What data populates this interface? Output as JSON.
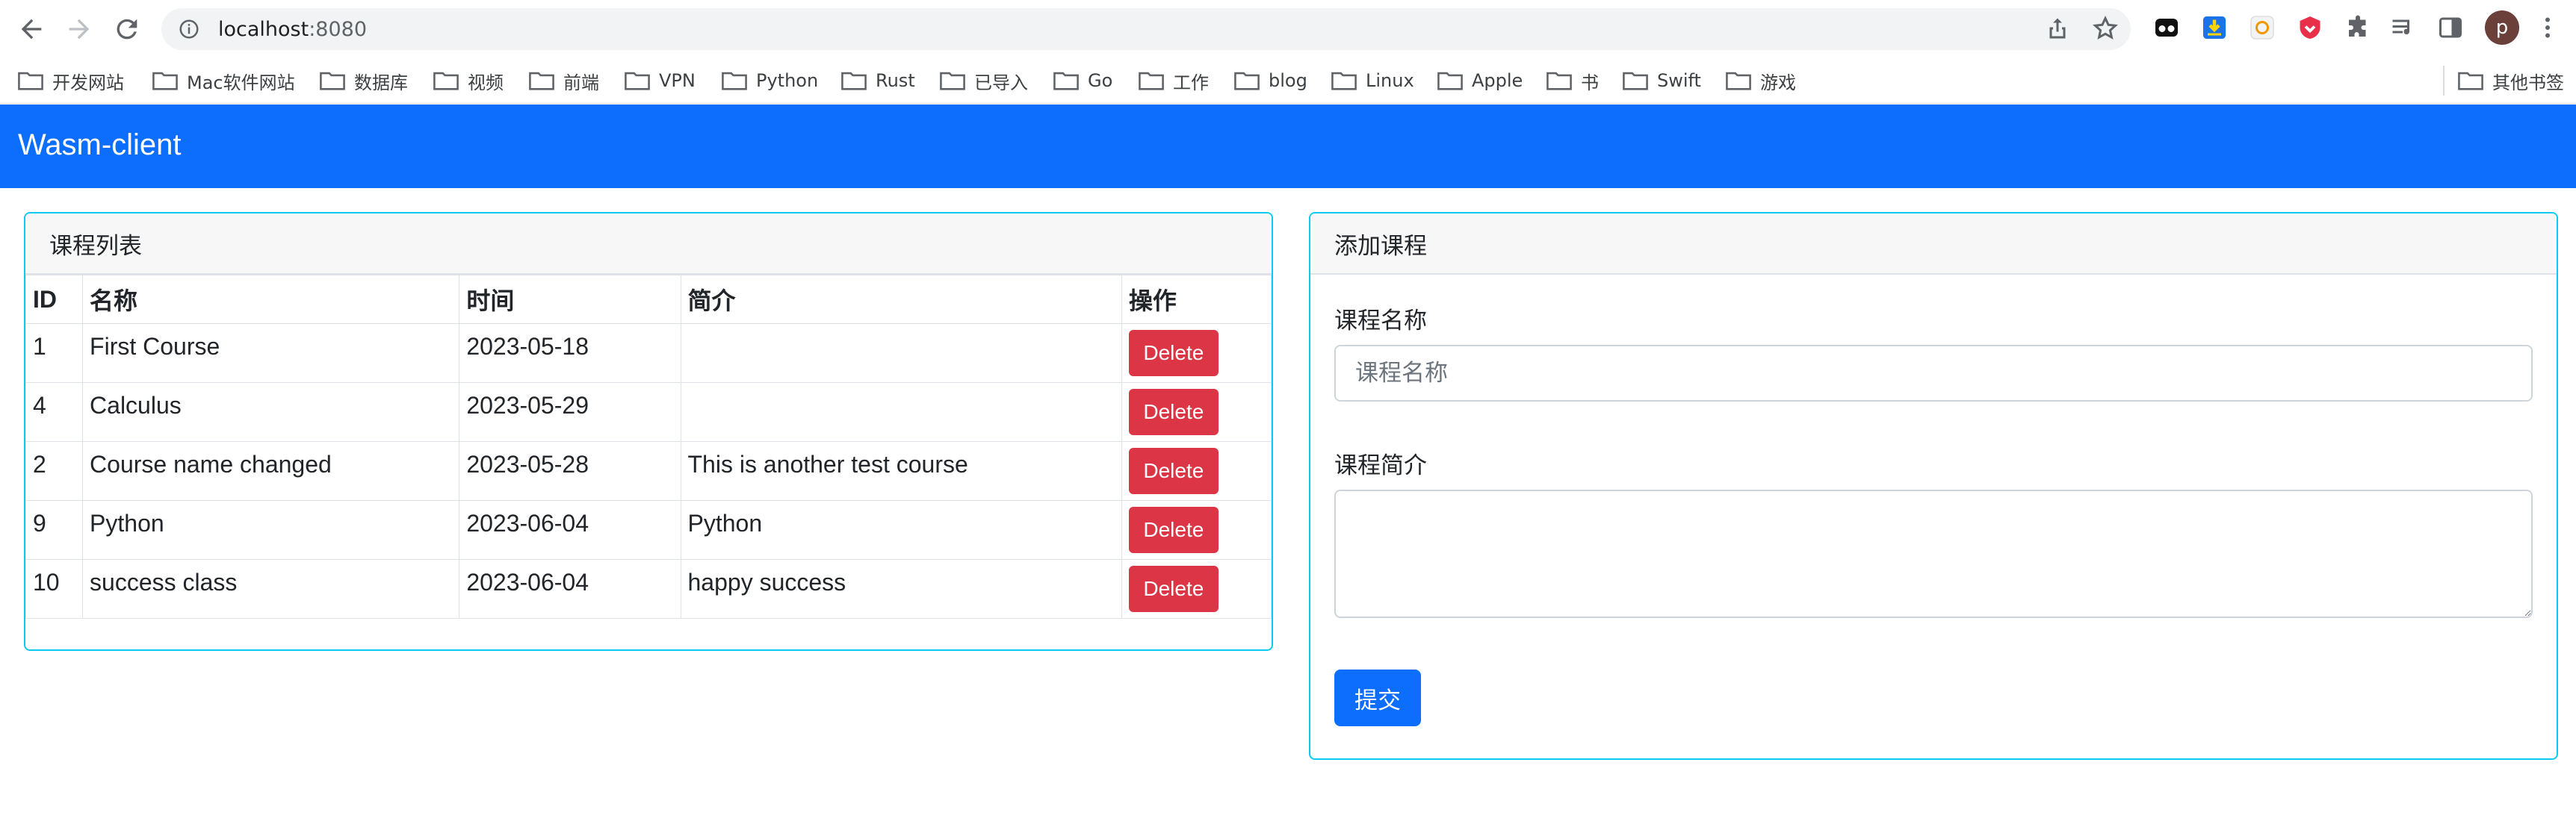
{
  "browser": {
    "url_host": "localhost",
    "url_port": ":8080",
    "avatar_letter": "p",
    "bookmarks": [
      "开发网站",
      "Mac软件网站",
      "数据库",
      "视频",
      "前端",
      "VPN",
      "Python",
      "Rust",
      "已导入",
      "Go",
      "工作",
      "blog",
      "Linux",
      "Apple",
      "书",
      "Swift",
      "游戏"
    ],
    "other_bookmarks": "其他书签"
  },
  "app": {
    "brand": "Wasm-client"
  },
  "course_list": {
    "title": "课程列表",
    "columns": [
      "ID",
      "名称",
      "时间",
      "简介",
      "操作"
    ],
    "rows": [
      {
        "id": "1",
        "name": "First Course",
        "time": "2023-05-18",
        "desc": "",
        "action": "Delete"
      },
      {
        "id": "4",
        "name": "Calculus",
        "time": "2023-05-29",
        "desc": "",
        "action": "Delete"
      },
      {
        "id": "2",
        "name": "Course name changed",
        "time": "2023-05-28",
        "desc": "This is another test course",
        "action": "Delete"
      },
      {
        "id": "9",
        "name": "Python",
        "time": "2023-06-04",
        "desc": "Python",
        "action": "Delete"
      },
      {
        "id": "10",
        "name": "success class",
        "time": "2023-06-04",
        "desc": "happy success",
        "action": "Delete"
      }
    ]
  },
  "add_course": {
    "title": "添加课程",
    "name_label": "课程名称",
    "name_placeholder": "课程名称",
    "name_value": "",
    "desc_label": "课程简介",
    "desc_value": "",
    "submit_label": "提交"
  }
}
